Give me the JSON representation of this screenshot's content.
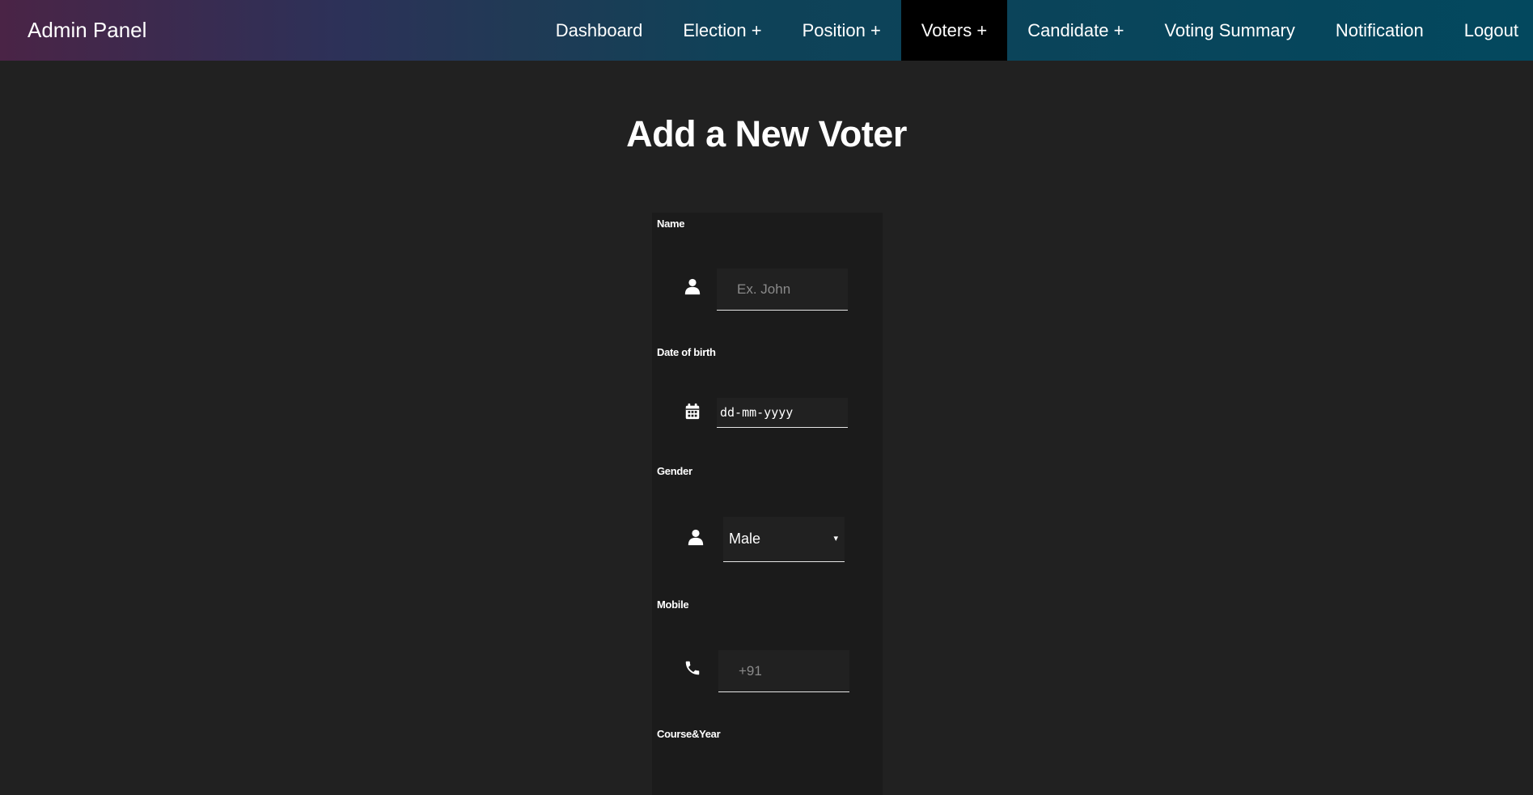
{
  "header": {
    "brand": "Admin Panel",
    "nav": [
      {
        "label": "Dashboard"
      },
      {
        "label": "Election +"
      },
      {
        "label": "Position +"
      },
      {
        "label": "Voters +",
        "active": true
      },
      {
        "label": "Candidate +"
      },
      {
        "label": "Voting Summary"
      },
      {
        "label": "Notification"
      },
      {
        "label": "Logout"
      }
    ]
  },
  "page": {
    "title": "Add a New Voter"
  },
  "form": {
    "name": {
      "label": "Name",
      "placeholder": "Ex. John",
      "icon": "user-icon"
    },
    "dob": {
      "label": "Date of birth",
      "placeholder": "dd-mm-yyyy",
      "icon": "calendar-icon"
    },
    "gender": {
      "label": "Gender",
      "selected": "Male",
      "caret": "▾",
      "icon": "user-icon"
    },
    "mobile": {
      "label": "Mobile",
      "placeholder": "+91",
      "icon": "phone-icon"
    },
    "course": {
      "label": "Course&Year"
    }
  },
  "colors": {
    "page_bg": "#212121",
    "panel_bg": "#1b1b1b",
    "active_nav_bg": "#000000",
    "header_gradient_start": "#4a2446",
    "header_gradient_end": "#03485e"
  }
}
